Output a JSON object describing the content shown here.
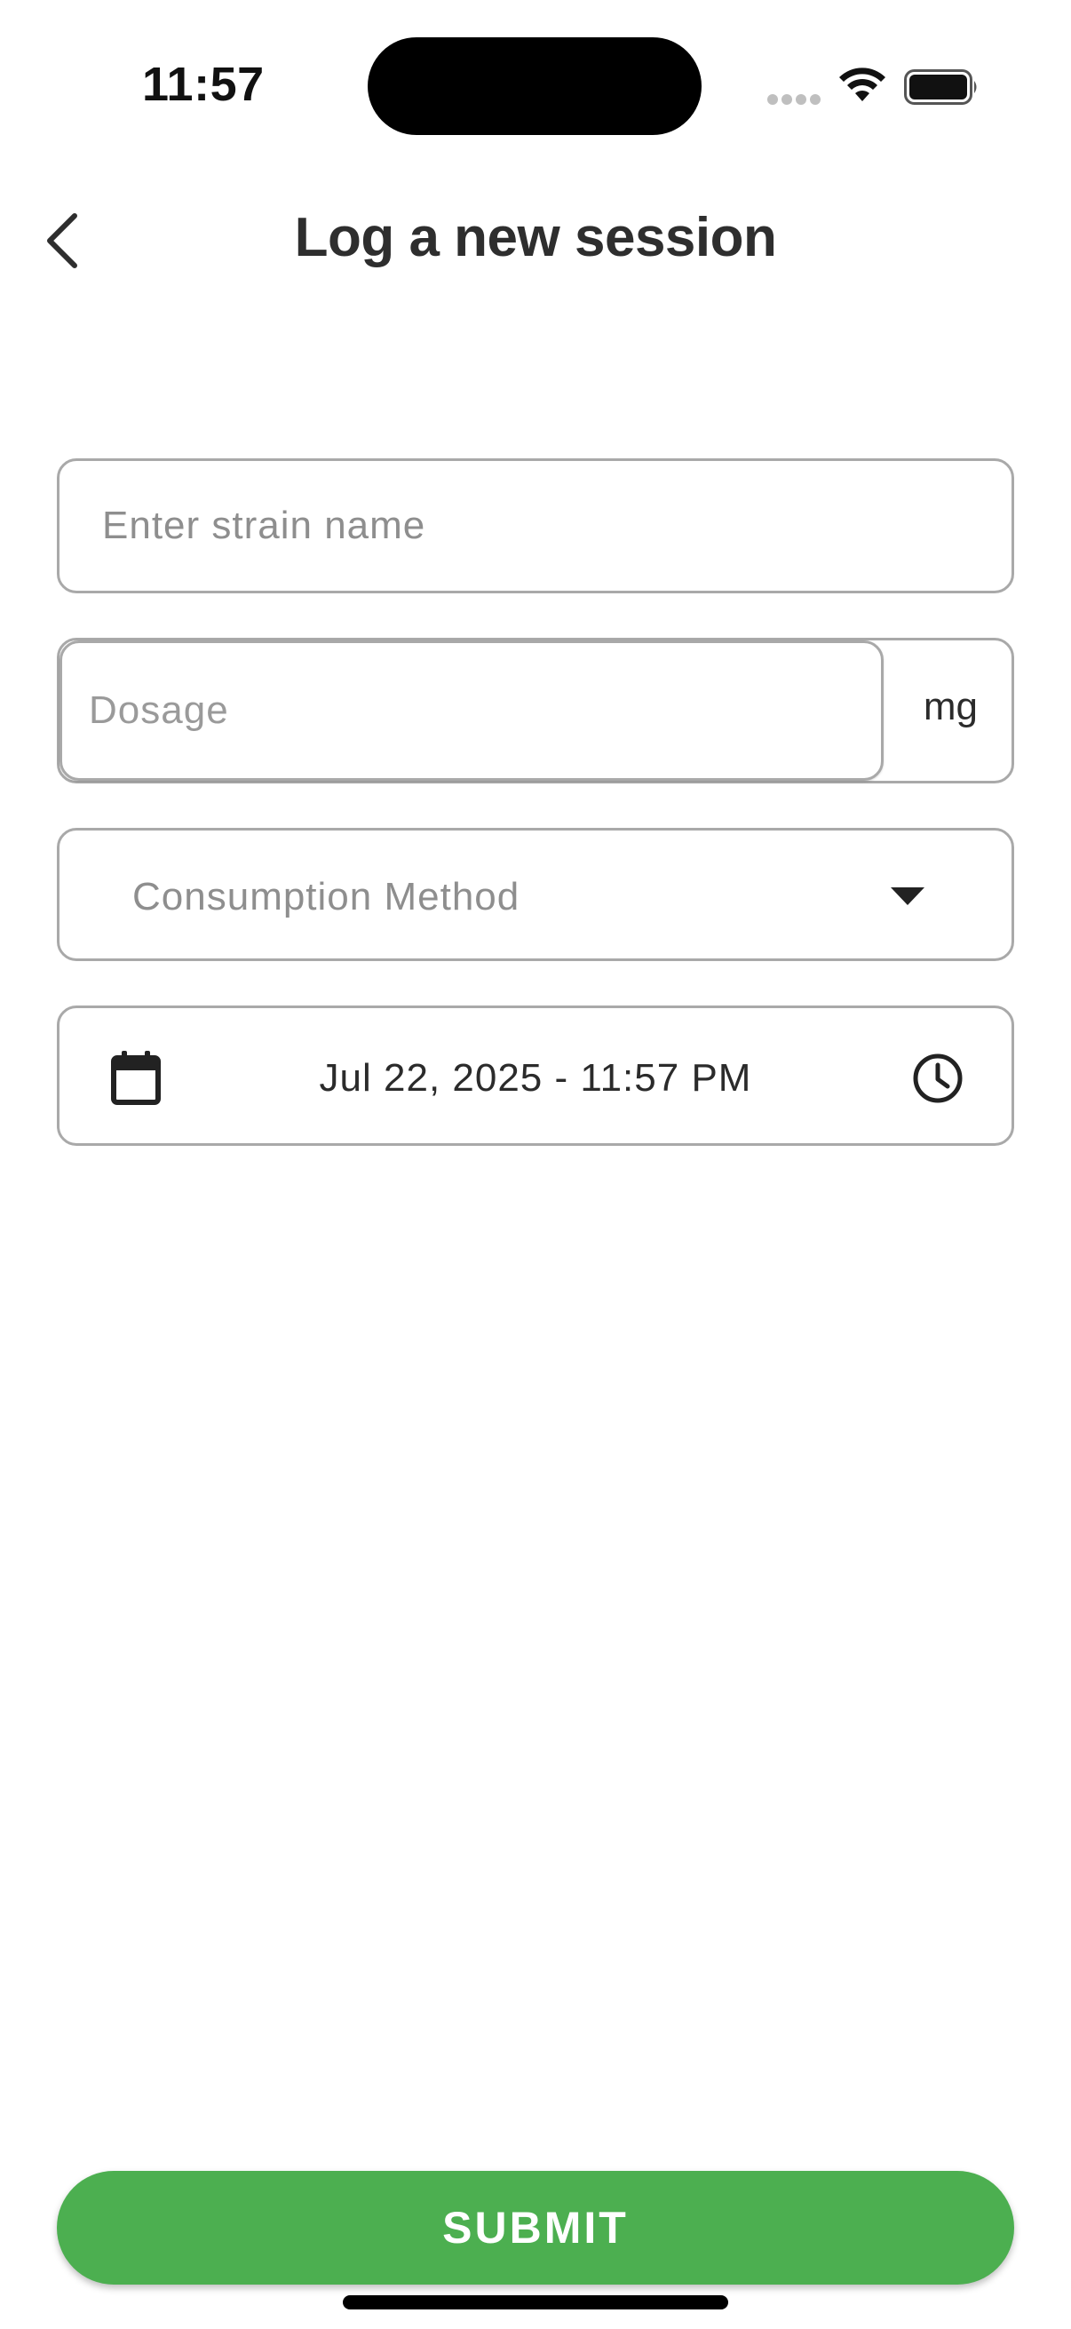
{
  "status_bar": {
    "time": "11:57",
    "icons": [
      "signal-dots-icon",
      "wifi-icon",
      "battery-icon"
    ]
  },
  "header": {
    "back_icon": "chevron-left-icon",
    "title": "Log a new session"
  },
  "form": {
    "strain": {
      "value": "",
      "placeholder": "Enter strain name"
    },
    "dosage": {
      "value": "",
      "placeholder": "Dosage",
      "unit": "mg"
    },
    "consumption_method": {
      "label": "Consumption Method",
      "icon": "dropdown-arrow-icon"
    },
    "datetime": {
      "value": "Jul 22, 2025 - 11:57 PM",
      "left_icon": "calendar-icon",
      "right_icon": "clock-icon"
    }
  },
  "submit": {
    "label": "SUBMIT"
  },
  "colors": {
    "accent": "#4caf50",
    "border": "#a9a9a9",
    "placeholder": "#8e8e8e",
    "text": "#2b2b2b"
  }
}
